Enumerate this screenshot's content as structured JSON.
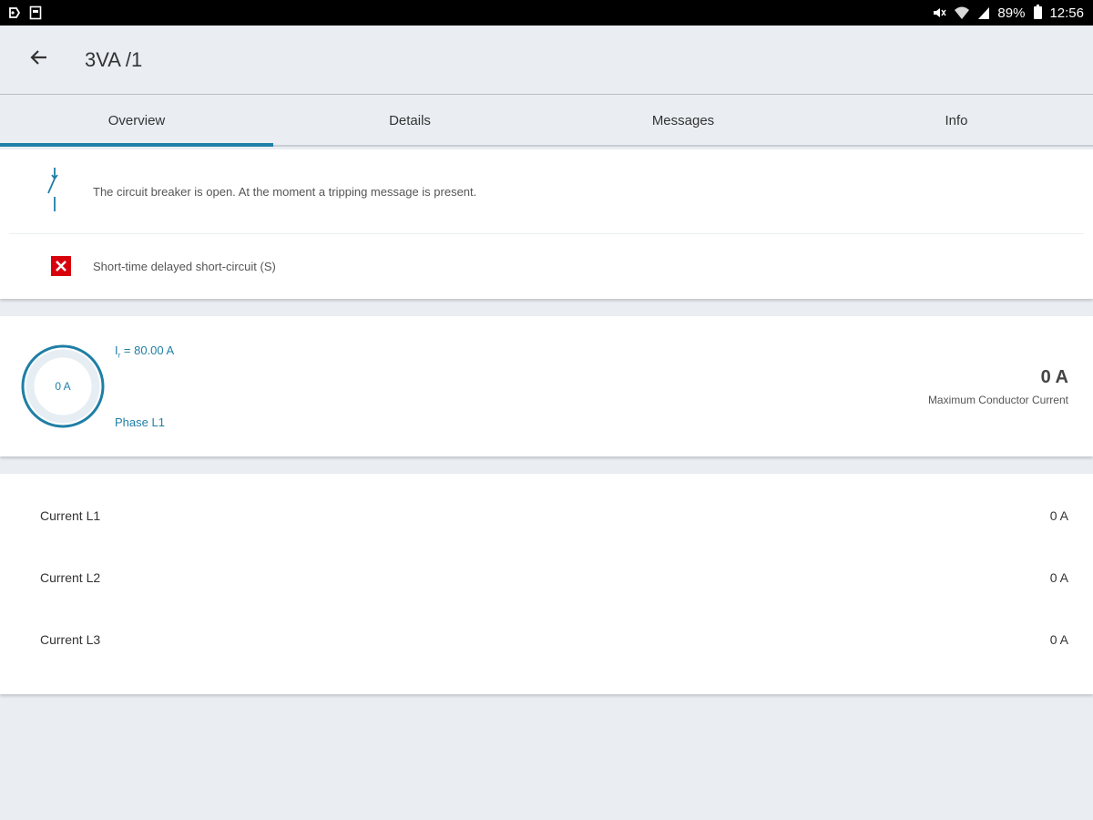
{
  "statusbar": {
    "battery": "89%",
    "time": "12:56",
    "icons": [
      "usb-icon",
      "storage-icon",
      "mute-icon",
      "wifi-icon",
      "signal-icon",
      "battery-icon"
    ]
  },
  "appbar": {
    "title": "3VA /1",
    "back_icon": "arrow-left-icon"
  },
  "tabs": [
    {
      "label": "Overview",
      "active": true
    },
    {
      "label": "Details",
      "active": false
    },
    {
      "label": "Messages",
      "active": false
    },
    {
      "label": "Info",
      "active": false
    }
  ],
  "status": {
    "breaker_message": "The circuit breaker is open. At the moment a tripping message is present.",
    "trip_message": "Short-time delayed short-circuit (S)"
  },
  "gauge": {
    "value": "0 A",
    "ir_symbol": "I",
    "ir_subscript": "r",
    "ir_value": " = 80.00 A",
    "phase": "Phase L1",
    "max_value": "0 A",
    "max_label": "Maximum Conductor Current",
    "accent_color": "#1f7fa6"
  },
  "currents": [
    {
      "label": "Current L1",
      "value": "0 A"
    },
    {
      "label": "Current L2",
      "value": "0 A"
    },
    {
      "label": "Current L3",
      "value": "0 A"
    }
  ]
}
